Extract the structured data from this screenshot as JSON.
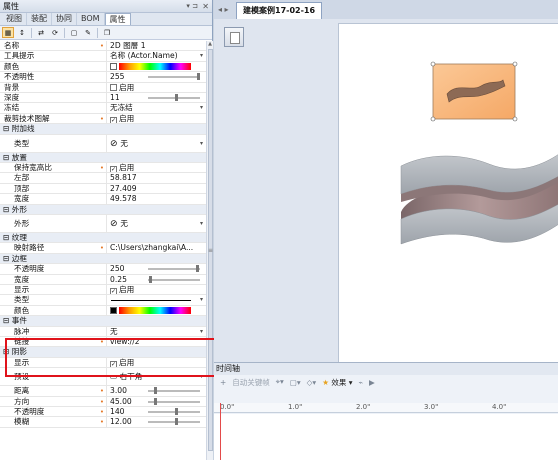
{
  "props": {
    "title": "属性",
    "tabs": [
      "视图",
      "装配",
      "协同",
      "BOM",
      "属性"
    ],
    "rows": [
      {
        "k": "名称",
        "v": "2D 图層 1",
        "type": "text",
        "mark": true
      },
      {
        "k": "工具提示",
        "v": "名称 (Actor.Name)",
        "type": "dropdown"
      },
      {
        "k": "颜色",
        "v": "",
        "type": "color"
      },
      {
        "k": "不透明性",
        "v": "255",
        "type": "slider",
        "pos": 1.0
      },
      {
        "k": "背景",
        "v": "启用",
        "type": "check",
        "checked": false
      },
      {
        "k": "深度",
        "v": "11",
        "type": "slider",
        "pos": 0.55
      },
      {
        "k": "冻结",
        "v": "无冻结",
        "type": "dropdown"
      },
      {
        "k": "裁剪技术图解",
        "v": "启用",
        "type": "check",
        "checked": true,
        "mark": true
      },
      {
        "k": "附加线",
        "type": "cat"
      },
      {
        "k": "类型",
        "v": "无",
        "type": "none",
        "ind": true,
        "tall": true
      },
      {
        "k": "放置",
        "type": "cat"
      },
      {
        "k": "保持宽高比",
        "v": "启用",
        "type": "check",
        "checked": true,
        "ind": true,
        "mark": true
      },
      {
        "k": "左部",
        "v": "58.817",
        "type": "text",
        "ind": true
      },
      {
        "k": "顶部",
        "v": "27.409",
        "type": "text",
        "ind": true
      },
      {
        "k": "宽度",
        "v": "49.578",
        "type": "text",
        "ind": true
      },
      {
        "k": "外形",
        "type": "cat"
      },
      {
        "k": "外形",
        "v": "无",
        "type": "none",
        "ind": true,
        "tall": true
      },
      {
        "k": "纹理",
        "type": "cat"
      },
      {
        "k": "映射路径",
        "v": "C:\\Users\\zhangkai\\A...",
        "type": "text",
        "ind": true,
        "mark": true
      },
      {
        "k": "边框",
        "type": "cat"
      },
      {
        "k": "不透明度",
        "v": "250",
        "type": "slider",
        "pos": 0.98,
        "ind": true
      },
      {
        "k": "宽度",
        "v": "0.25",
        "type": "slider",
        "pos": 0.02,
        "ind": true
      },
      {
        "k": "显示",
        "v": "启用",
        "type": "check",
        "checked": true,
        "ind": true
      },
      {
        "k": "类型",
        "v": "",
        "type": "line",
        "ind": true
      },
      {
        "k": "颜色",
        "v": "",
        "type": "colorblack",
        "ind": true
      },
      {
        "k": "事件",
        "type": "cat"
      },
      {
        "k": "脉冲",
        "v": "无",
        "type": "dropdown",
        "ind": true
      },
      {
        "k": "链接",
        "v": "view://2",
        "type": "text",
        "ind": true,
        "mark": true
      },
      {
        "k": "阴影",
        "type": "cat"
      },
      {
        "k": "显示",
        "v": "启用",
        "type": "check",
        "checked": true,
        "ind": true
      },
      {
        "k": "预设",
        "v": "右下角",
        "type": "preset",
        "ind": true,
        "tall": true
      },
      {
        "k": "距离",
        "v": "3.00",
        "type": "slider",
        "pos": 0.12,
        "ind": true,
        "mark": true
      },
      {
        "k": "方向",
        "v": "45.00",
        "type": "slider",
        "pos": 0.12,
        "ind": true,
        "mark": true
      },
      {
        "k": "不透明度",
        "v": "140",
        "type": "slider",
        "pos": 0.55,
        "ind": true,
        "mark": true
      },
      {
        "k": "模糊",
        "v": "12.00",
        "type": "slider",
        "pos": 0.55,
        "ind": true,
        "mark": true
      }
    ]
  },
  "doc": {
    "tab_label": "建模案例17-02-16"
  },
  "timeline": {
    "title": "时间轴",
    "add_keyframe": "自动关键帧",
    "effects_label": "效果",
    "ruler": [
      "0.0\"",
      "1.0\"",
      "2.0\"",
      "3.0\"",
      "4.0\""
    ]
  },
  "colors": {
    "accent_orange": "#f8b47a",
    "highlight_red": "#e0131b"
  }
}
